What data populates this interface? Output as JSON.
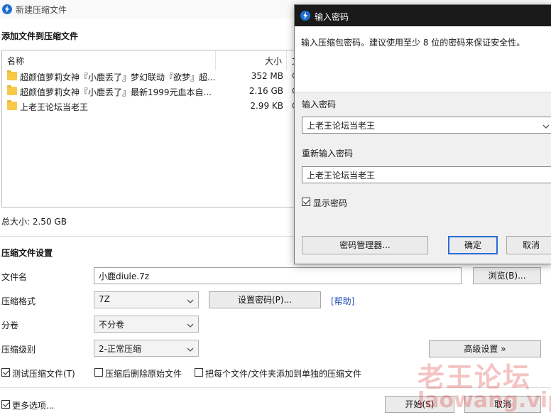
{
  "main_window": {
    "title": "新建压缩文件",
    "add_section_title": "添加文件到压缩文件",
    "columns": {
      "name": "名称",
      "size": "大小",
      "extra": "文"
    },
    "files": [
      {
        "name": "超颜值萝莉女神『小鹿丢了』梦幻联动『欲梦』超...",
        "size": "352 MB",
        "extra": "C"
      },
      {
        "name": "超颜值萝莉女神『小鹿丢了』最新1999元血本自...",
        "size": "2.16 GB",
        "extra": "C"
      },
      {
        "name": "上老王论坛当老王",
        "size": "2.99 KB",
        "extra": "C"
      }
    ],
    "total_size": "总大小: 2.50 GB",
    "settings_title": "压缩文件设置",
    "filename_label": "文件名",
    "filename_value": "小鹿diule.7z",
    "browse_button": "浏览(B)...",
    "format_label": "压缩格式",
    "format_value": "7Z",
    "set_password_button": "设置密码(P)...",
    "help_link": "[帮助]",
    "split_label": "分卷",
    "split_value": "不分卷",
    "level_label": "压缩级别",
    "level_value": "2-正常压缩",
    "advanced_button": "高级设置 »",
    "test_checkbox": "测试压缩文件(T)",
    "delete_checkbox": "压缩后删除原始文件",
    "separate_checkbox": "把每个文件/文件夹添加到单独的压缩文件",
    "more_options": "更多选项...",
    "start_button": "开始(S)",
    "cancel_button": "取消"
  },
  "password_dialog": {
    "title": "输入密码",
    "description": "输入压缩包密码。建议使用至少 8 位的密码来保证安全性。",
    "enter_label": "输入密码",
    "enter_value": "上老王论坛当老王",
    "reenter_label": "重新输入密码",
    "reenter_value": "上老王论坛当老王",
    "show_password": "显示密码",
    "manager_button": "密码管理器...",
    "ok_button": "确定",
    "cancel_button": "取消"
  },
  "watermark": {
    "text_cn": "老王论坛",
    "text_en": "laowang.vip"
  },
  "colors": {
    "accent": "#2a6cd6",
    "folder": "#f7c948",
    "link": "#1f4fb3",
    "dialog_titlebar": "#1a1a1a"
  },
  "icons": [
    "app-icon",
    "folder-icon",
    "chevron-down-icon",
    "checkbox-icon"
  ]
}
